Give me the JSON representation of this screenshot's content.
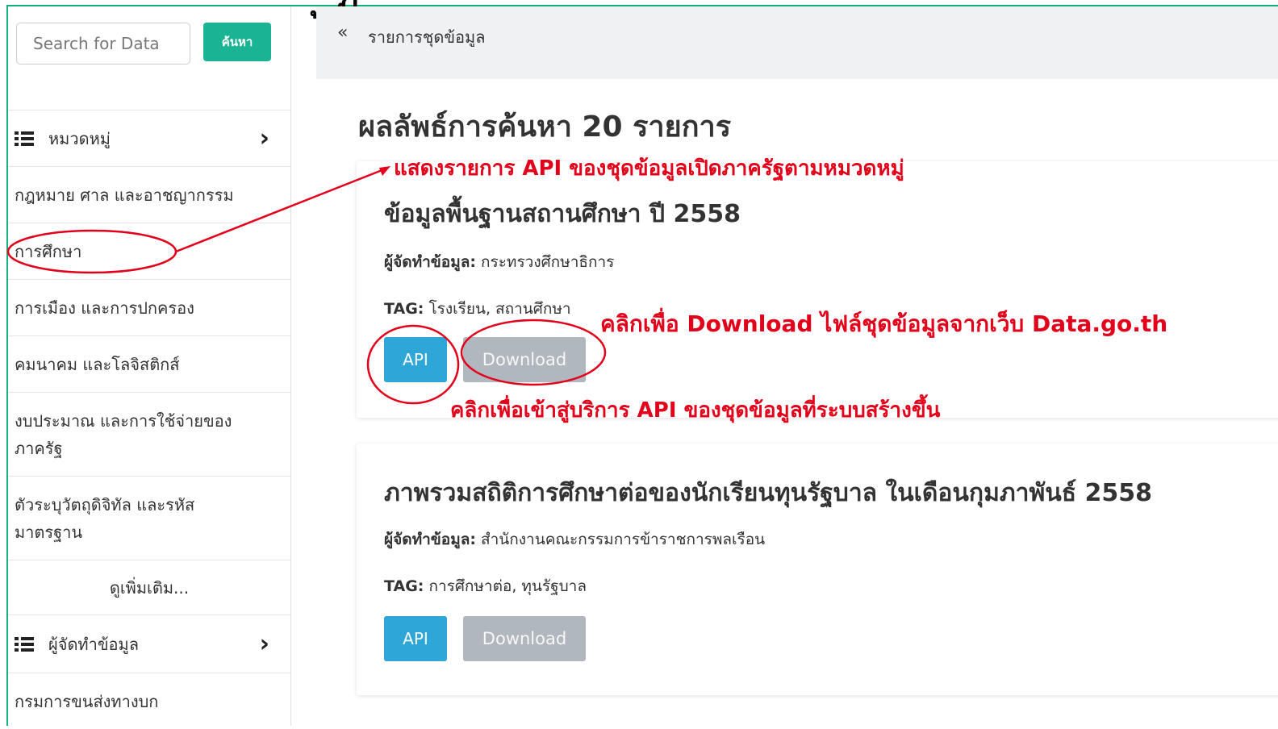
{
  "slide_heading": "ู้               ฏ               ู",
  "search": {
    "placeholder": "Search for Data",
    "button_label": "ค้นหา"
  },
  "sidebar": {
    "categories_header": "หมวดหมู่",
    "category_items": [
      "กฎหมาย ศาล และอาชญากรรม",
      "การศึกษา",
      "การเมือง และการปกครอง",
      "คมนาคม และโลจิสติกส์",
      "งบประมาณ และการใช้จ่ายของ",
      "ภาครัฐ",
      "ตัวระบุวัตถุดิจิทัล และรหัส",
      "มาตรฐาน"
    ],
    "see_more": "ดูเพิ่มเติม...",
    "publishers_header": "ผู้จัดทำข้อมูล",
    "publisher_items": [
      "กรมการขนส่งทางบก"
    ]
  },
  "breadcrumb": {
    "back_icon": "«",
    "label": "รายการชุดข้อมูล"
  },
  "results": {
    "title": "ผลลัพธ์การค้นหา 20 รายการ",
    "datasets": [
      {
        "title": "ข้อมูลพื้นฐานสถานศึกษา ปี 2558",
        "publisher_label": "ผู้จัดทำข้อมูล:",
        "publisher": "กระทรวงศึกษาธิการ",
        "tag_label": "TAG:",
        "tags": "โรงเรียน, สถานศึกษา",
        "api_label": "API",
        "download_label": "Download"
      },
      {
        "title": "ภาพรวมสถิติการศึกษาต่อของนักเรียนทุนรัฐบาล ในเดือนกุมภาพันธ์ 2558",
        "publisher_label": "ผู้จัดทำข้อมูล:",
        "publisher": "สำนักงานคณะกรรมการข้าราชการพลเรือน",
        "tag_label": "TAG:",
        "tags": "การศึกษาต่อ, ทุนรัฐบาล",
        "api_label": "API",
        "download_label": "Download"
      }
    ]
  },
  "annotations": {
    "category_note": "แสดงรายการ API ของชุดข้อมูลเปิดภาครัฐตามหมวดหมู่",
    "download_note": "คลิกเพื่อ Download ไฟล์ชุดข้อมูลจากเว็บ Data.go.th",
    "api_note": "คลิกเพื่อเข้าสู่บริการ API ของชุดข้อมูลที่ระบบสร้างขึ้น",
    "color": "#e2001a"
  },
  "colors": {
    "accent_green": "#1ab394",
    "api_blue": "#2ea7d8",
    "download_gray": "#b1b7bf"
  }
}
